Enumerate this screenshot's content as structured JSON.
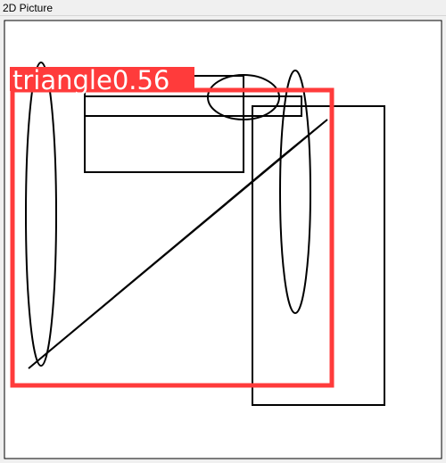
{
  "window": {
    "title": "2D Picture"
  },
  "detection": {
    "label": "triangle",
    "score": "0.56",
    "box_color": "#ff3b3b",
    "label_text_color": "#ffffff"
  },
  "colors": {
    "canvas_bg": "#ffffff",
    "stroke": "#000000",
    "window_bg": "#f0f0f0"
  }
}
